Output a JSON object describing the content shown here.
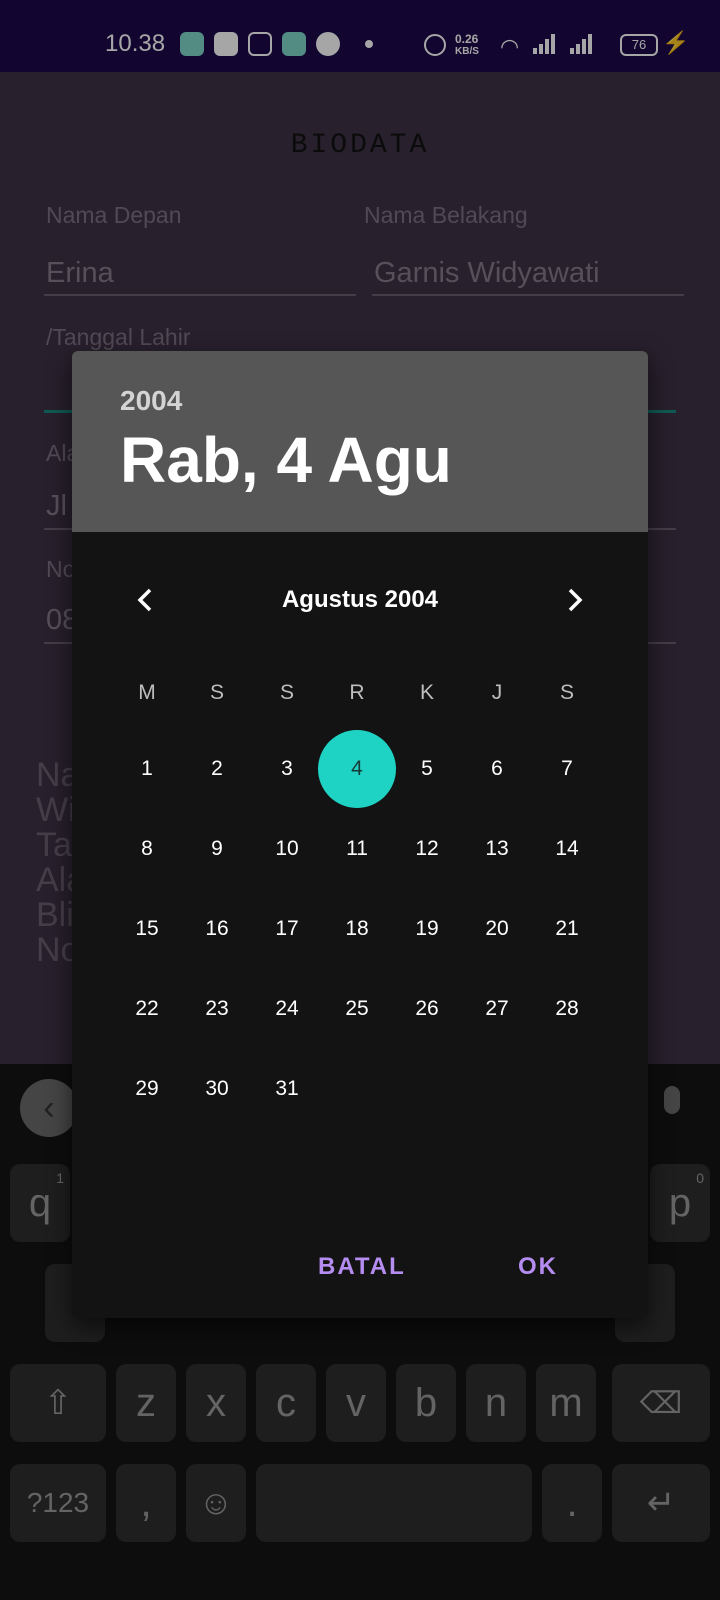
{
  "status_bar": {
    "time": "10.38",
    "net_speed": "0.26",
    "net_unit": "KB/S",
    "battery": "76"
  },
  "form": {
    "title": "BIODATA",
    "first_name_label": "Nama Depan",
    "first_name_value": "Erina",
    "last_name_label": "Nama Belakang",
    "last_name_value": "Garnis Widyawati",
    "birthdate_label": "/Tanggal Lahir",
    "address_label_partial": "Ala",
    "address_value_partial": "Jl",
    "phone_label_partial": "No",
    "phone_value_partial": "08",
    "summary_lines_partial": [
      "Na",
      "Wi",
      "Ta",
      "Ala",
      "Bli",
      "No"
    ]
  },
  "date_picker": {
    "header_year": "2004",
    "header_date": "Rab, 4 Agu",
    "month_label": "Agustus 2004",
    "weekdays": [
      "M",
      "S",
      "S",
      "R",
      "K",
      "J",
      "S"
    ],
    "first_weekday_index": 0,
    "days_in_month": 31,
    "selected_day": 4,
    "cancel_label": "BATAL",
    "ok_label": "OK"
  },
  "keyboard": {
    "row_letters": [
      "z",
      "x",
      "c",
      "v",
      "b",
      "n",
      "m"
    ],
    "q_key": "q",
    "q_hint": "1",
    "p_key": "p",
    "p_hint": "0",
    "symbols_key": "?123",
    "comma_key": ",",
    "period_key": "."
  },
  "colors": {
    "accent": "#1fd3c4",
    "button_text": "#b58cf0",
    "status_bar": "#1d0a4a"
  }
}
